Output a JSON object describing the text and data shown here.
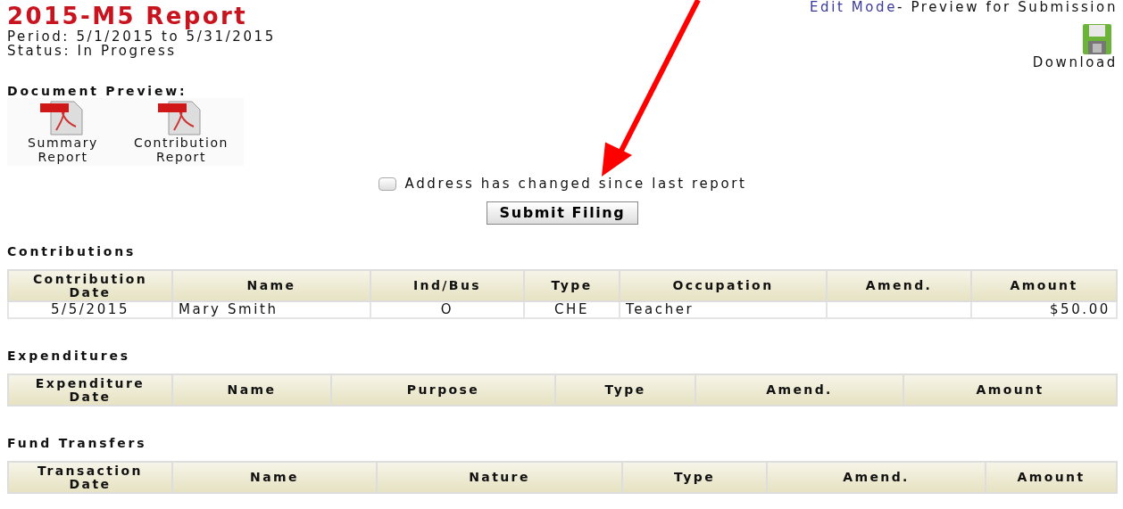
{
  "report": {
    "title": "2015-M5 Report",
    "period": "Period: 5/1/2015 to 5/31/2015",
    "status": "Status: In Progress"
  },
  "mode": {
    "link": "Edit Mode",
    "text": "- Preview for Submission"
  },
  "download": {
    "label": "Download"
  },
  "document_preview": {
    "heading": "Document Preview:",
    "documents": [
      {
        "label": "Summary Report"
      },
      {
        "label": "Contribution Report"
      }
    ]
  },
  "address_changed": {
    "label": "Address has changed since last report",
    "checked": false
  },
  "submit_button": "Submit Filing",
  "sections": [
    {
      "heading": "Contributions",
      "columns": [
        "Contribution Date",
        "Name",
        "Ind/Bus",
        "Type",
        "Occupation",
        "Amend.",
        "Amount"
      ],
      "rows": [
        [
          "5/5/2015",
          "Mary Smith",
          "O",
          "CHE",
          "Teacher",
          "",
          "$50.00"
        ]
      ]
    },
    {
      "heading": "Expenditures",
      "columns": [
        "Expenditure Date",
        "Name",
        "Purpose",
        "Type",
        "Amend.",
        "Amount"
      ]
    },
    {
      "heading": "Fund Transfers",
      "columns": [
        "Transaction Date",
        "Name",
        "Nature",
        "Type",
        "Amend.",
        "Amount"
      ]
    }
  ]
}
